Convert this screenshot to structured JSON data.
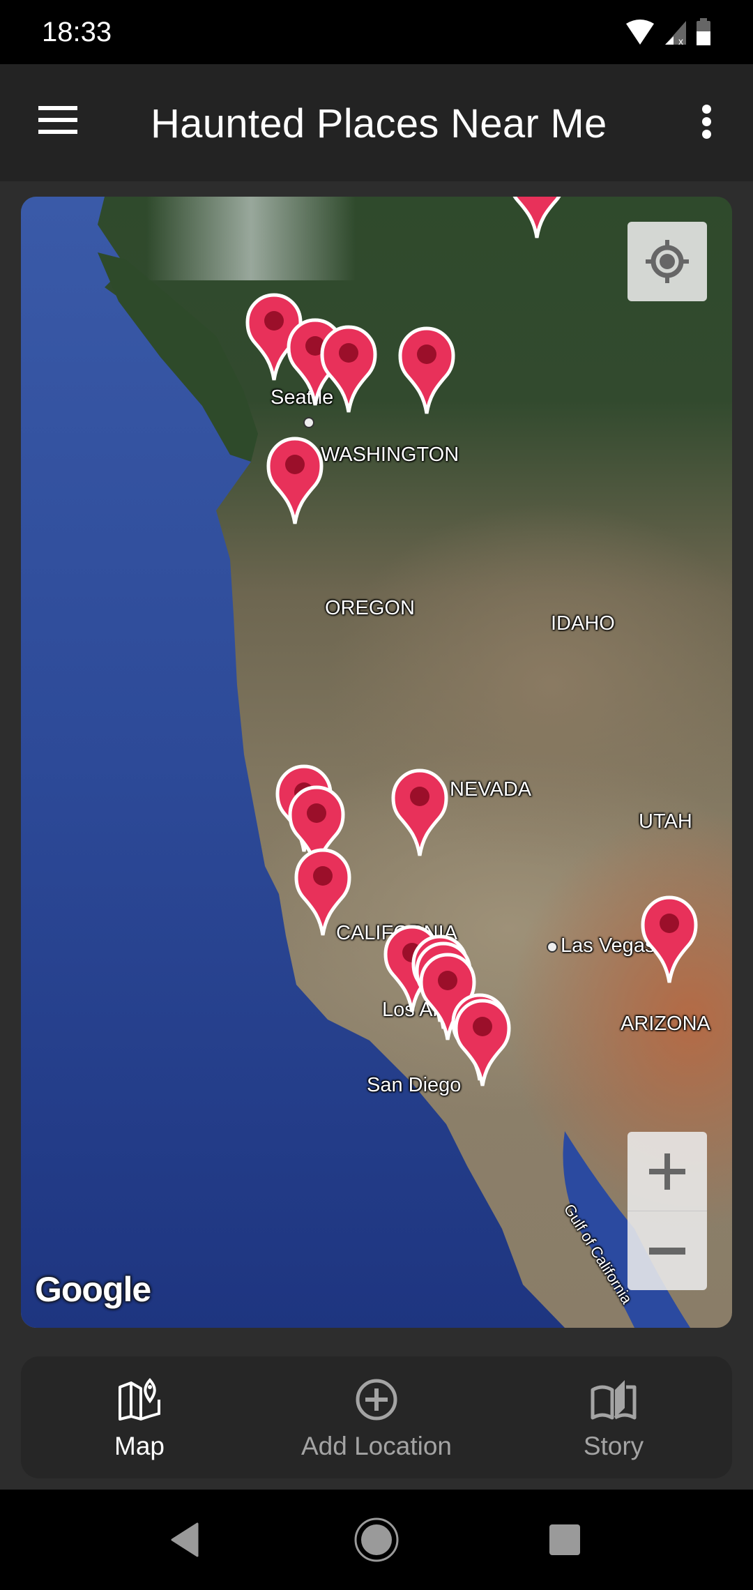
{
  "status_bar": {
    "time": "18:33",
    "icons": [
      "wifi-icon",
      "cellular-no-signal-icon",
      "battery-icon"
    ]
  },
  "app_bar": {
    "title": "Haunted Places Near Me",
    "menu_icon": "hamburger-menu-icon",
    "overflow_icon": "more-vert-icon"
  },
  "map": {
    "provider_logo": "Google",
    "labels": {
      "seattle": "Seattle",
      "washington": "WASHINGTON",
      "oregon": "OREGON",
      "idaho": "IDAHO",
      "nevada": "NEVADA",
      "utah": "UTAH",
      "california": "CALIFORNIA",
      "las_vegas": "Las Vegas",
      "los_angeles": "Los Angeles",
      "san_diego": "San Diego",
      "arizona": "ARIZONA",
      "gulf_of_california": "Gulf of California"
    },
    "marker_color": "#e8315a",
    "marker_dot_color": "#9b0f2a",
    "marker_count": 18,
    "controls": {
      "my_location_icon": "my-location-icon",
      "zoom_in_label": "+",
      "zoom_out_label": "−"
    }
  },
  "bottom_nav": {
    "items": [
      {
        "label": "Map",
        "icon": "map-icon",
        "active": true
      },
      {
        "label": "Add Location",
        "icon": "add-circle-icon",
        "active": false
      },
      {
        "label": "Story",
        "icon": "book-icon",
        "active": false
      }
    ]
  },
  "system_nav": {
    "back_icon": "back-icon",
    "home_icon": "home-icon",
    "recents_icon": "recents-icon"
  }
}
